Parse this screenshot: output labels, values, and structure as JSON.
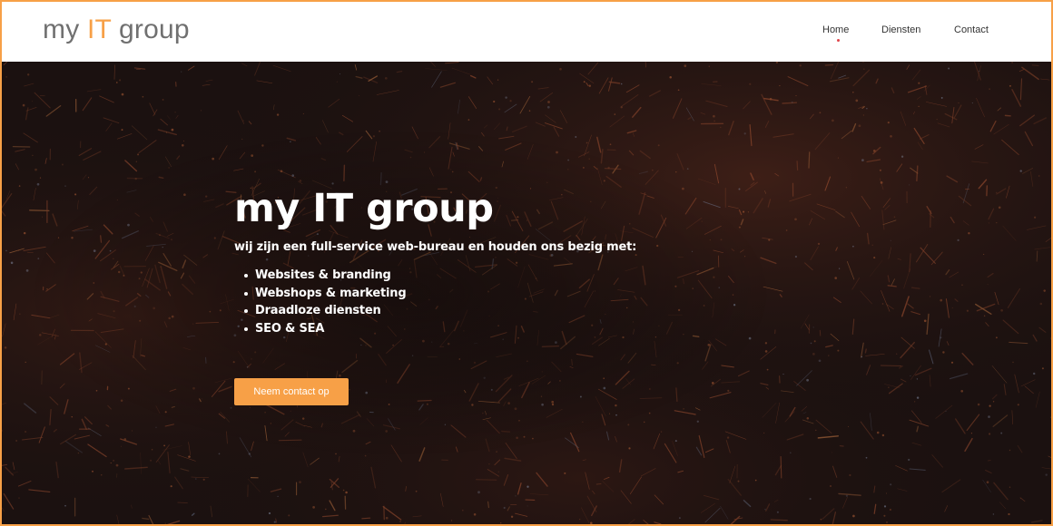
{
  "header": {
    "logo": {
      "part1": "my ",
      "accent": "IT",
      "part2": " group"
    },
    "nav": {
      "items": [
        {
          "label": "Home",
          "active": true
        },
        {
          "label": "Diensten",
          "active": false
        },
        {
          "label": "Contact",
          "active": false
        }
      ]
    }
  },
  "hero": {
    "title": "my IT group",
    "subtitle": "wij zijn een full-service web-bureau en houden ons bezig met:",
    "services": [
      "Websites & branding",
      "Webshops & marketing",
      "Draadloze diensten",
      "SEO & SEA"
    ],
    "cta_label": "Neem contact op",
    "background_description": "aerial-night-city-lights"
  },
  "colors": {
    "accent": "#f7a047",
    "logo_gray": "#707070",
    "active_dot": "#e0454a",
    "hero_dark": "#1b1110"
  }
}
